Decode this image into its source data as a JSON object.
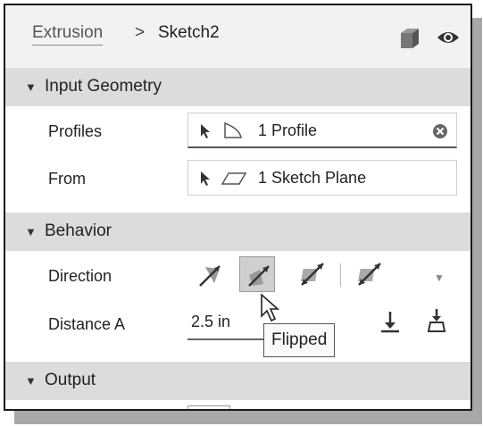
{
  "breadcrumb": {
    "feature": "Extrusion",
    "separator": ">",
    "sketch": "Sketch2"
  },
  "header_icons": {
    "cube": "cube-icon",
    "visibility": "eye-icon"
  },
  "sections": {
    "input_geometry": "Input Geometry",
    "behavior": "Behavior",
    "output": "Output"
  },
  "input_geometry": {
    "profiles_label": "Profiles",
    "profiles_value": "1 Profile",
    "from_label": "From",
    "from_value": "1 Sketch Plane"
  },
  "behavior": {
    "direction_label": "Direction",
    "direction_options": [
      "one-side-icon",
      "flipped-icon",
      "symmetric-icon",
      "two-sides-icon"
    ],
    "selected_direction": "flipped-icon",
    "distance_label": "Distance A",
    "distance_value": "2.5 in",
    "tooltip": "Flipped"
  },
  "colors": {
    "section_bg": "#dcdcdc",
    "header_bg": "#f2f2f2",
    "icon_dark": "#555555"
  }
}
